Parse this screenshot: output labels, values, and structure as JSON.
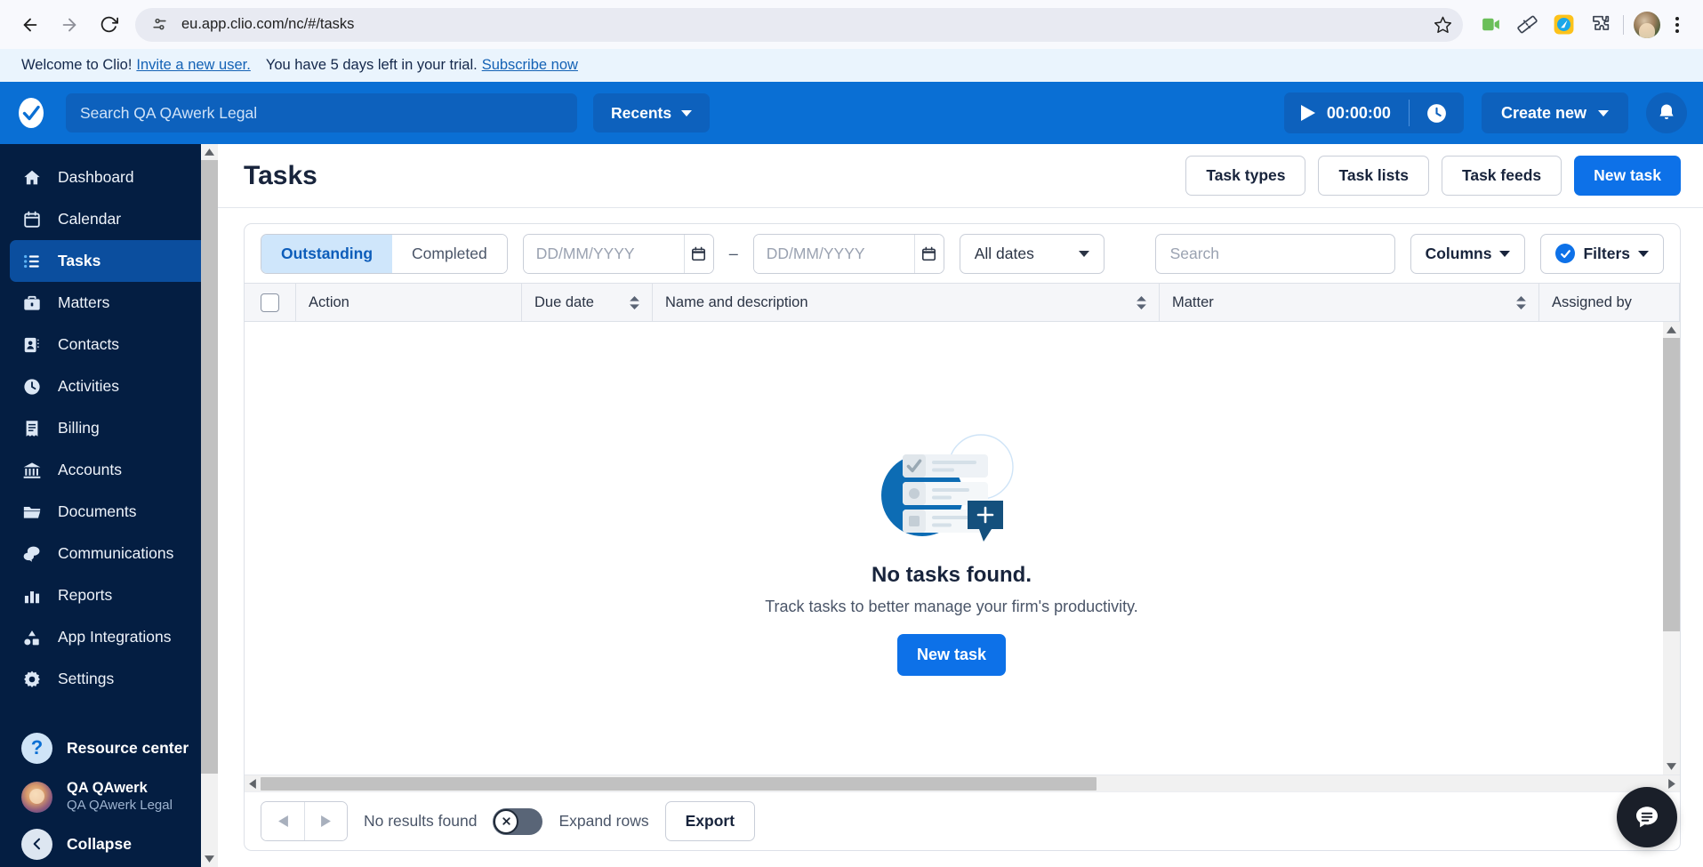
{
  "browser": {
    "url": "eu.app.clio.com/nc/#/tasks",
    "back_label": "Back",
    "forward_label": "Forward",
    "reload_label": "Reload",
    "site_info_label": "View site information",
    "bookmark_label": "Bookmark this tab",
    "extensions": [
      "video-camera-icon",
      "ruler-icon",
      "clio-extension-icon",
      "puzzle-piece-icon"
    ],
    "profile_label": "Profile",
    "menu_label": "Customize and control Chrome"
  },
  "banner": {
    "welcome": "Welcome to Clio!",
    "invite_link": "Invite a new user.",
    "trial_text": "You have 5 days left in your trial.",
    "subscribe_link": "Subscribe now"
  },
  "topbar": {
    "search_placeholder": "Search QA QAwerk Legal",
    "search_value": "",
    "recents_label": "Recents",
    "timer_value": "00:00:00",
    "create_new_label": "Create new",
    "notifications_label": "Notifications",
    "brand_color": "#0a6fd4"
  },
  "sidebar": {
    "items": [
      {
        "label": "Dashboard",
        "icon": "home-icon",
        "active": false
      },
      {
        "label": "Calendar",
        "icon": "calendar-icon",
        "active": false
      },
      {
        "label": "Tasks",
        "icon": "task-list-icon",
        "active": true
      },
      {
        "label": "Matters",
        "icon": "briefcase-icon",
        "active": false
      },
      {
        "label": "Contacts",
        "icon": "contact-card-icon",
        "active": false
      },
      {
        "label": "Activities",
        "icon": "clock-icon",
        "active": false
      },
      {
        "label": "Billing",
        "icon": "receipt-icon",
        "active": false
      },
      {
        "label": "Accounts",
        "icon": "bank-icon",
        "active": false
      },
      {
        "label": "Documents",
        "icon": "folder-icon",
        "active": false
      },
      {
        "label": "Communications",
        "icon": "chat-bubbles-icon",
        "active": false
      },
      {
        "label": "Reports",
        "icon": "bar-chart-icon",
        "active": false
      },
      {
        "label": "App Integrations",
        "icon": "shapes-icon",
        "active": false
      },
      {
        "label": "Settings",
        "icon": "gear-icon",
        "active": false
      }
    ],
    "resource_center": "Resource center",
    "user_name": "QA QAwerk",
    "user_org": "QA QAwerk Legal",
    "collapse_label": "Collapse"
  },
  "page": {
    "title": "Tasks",
    "header_buttons": [
      {
        "label": "Task types",
        "primary": false
      },
      {
        "label": "Task lists",
        "primary": false
      },
      {
        "label": "Task feeds",
        "primary": false
      },
      {
        "label": "New task",
        "primary": true
      }
    ]
  },
  "filters": {
    "status_tabs": [
      {
        "label": "Outstanding",
        "active": true
      },
      {
        "label": "Completed",
        "active": false
      }
    ],
    "date_from_placeholder": "DD/MM/YYYY",
    "date_from_value": "",
    "date_to_placeholder": "DD/MM/YYYY",
    "date_to_value": "",
    "range_separator": "–",
    "date_select_value": "All dates",
    "search_placeholder": "Search",
    "search_value": "",
    "columns_label": "Columns",
    "filters_label": "Filters"
  },
  "table": {
    "columns": [
      {
        "label": "Action",
        "sortable": false
      },
      {
        "label": "Due date",
        "sortable": true
      },
      {
        "label": "Name and description",
        "sortable": true
      },
      {
        "label": "Matter",
        "sortable": true
      },
      {
        "label": "Assigned by",
        "sortable": false
      }
    ],
    "select_all_label": "Select all rows"
  },
  "empty_state": {
    "title": "No tasks found.",
    "subtitle": "Track tasks to better manage your firm's productivity.",
    "button_label": "New task"
  },
  "footer": {
    "prev_label": "Previous page",
    "next_label": "Next page",
    "results_text": "No results found",
    "expand_rows_label": "Expand rows",
    "expand_rows_state": "off",
    "export_label": "Export"
  },
  "chat": {
    "label": "Open chat"
  }
}
